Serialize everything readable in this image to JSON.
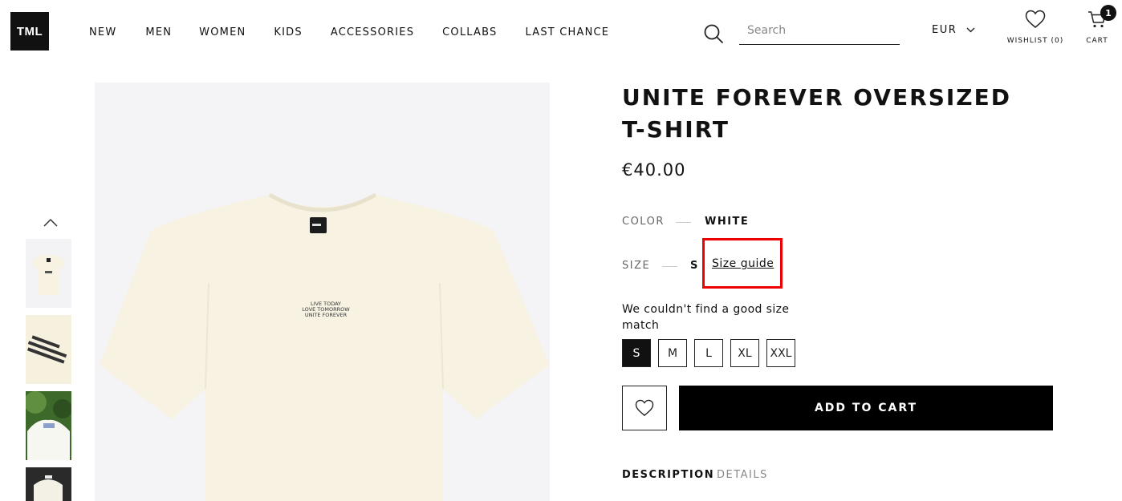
{
  "brand": {
    "logo_text": "TML"
  },
  "nav": {
    "items": [
      "NEW",
      "MEN",
      "WOMEN",
      "KIDS",
      "ACCESSORIES",
      "COLLABS",
      "LAST CHANCE"
    ]
  },
  "search": {
    "placeholder": "Search"
  },
  "currency": {
    "value": "EUR"
  },
  "header": {
    "wishlist_label": "WISHLIST (0)",
    "cart_label": "CART",
    "cart_count": "1"
  },
  "product": {
    "title": "UNITE FOREVER OVERSIZED T-SHIRT",
    "price": "€40.00",
    "print_text": [
      "LIVE TODAY",
      "LOVE TOMORROW",
      "UNITE FOREVER"
    ],
    "color_label": "COLOR",
    "color_value": "WHITE",
    "size_label": "SIZE",
    "size_value": "S",
    "size_guide": "Size guide",
    "fit_message": "We couldn't find a good size match",
    "sizes": [
      "S",
      "M",
      "L",
      "XL",
      "XXL"
    ],
    "selected_size": "S",
    "add_to_cart": "ADD TO CART"
  },
  "tabs": {
    "description": "DESCRIPTION",
    "details": "DETAILS"
  },
  "colors": {
    "primary": "#111111",
    "highlight": "#e00000",
    "image_bg": "#f4f3f6",
    "shirt": "#f7f2e2"
  },
  "icons": [
    "search-icon",
    "chevron-down-icon",
    "heart-icon",
    "cart-icon",
    "chevron-up-icon"
  ]
}
